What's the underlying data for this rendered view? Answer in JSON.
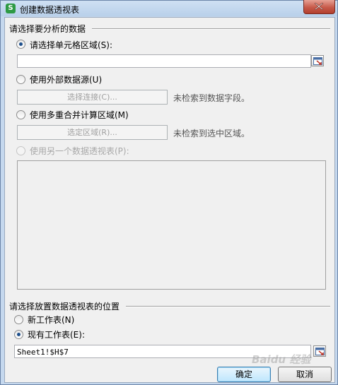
{
  "window": {
    "title": "创建数据透视表",
    "app_icon_glyph": "S",
    "app_icon_color": "#2e9a44",
    "close_icon": "close-icon"
  },
  "source_group": {
    "title": "请选择要分析的数据",
    "options": [
      {
        "label": "请选择单元格区域(S):",
        "checked": true,
        "enabled": true
      },
      {
        "label": "使用外部数据源(U)",
        "checked": false,
        "enabled": true
      },
      {
        "label": "使用多重合并计算区域(M)",
        "checked": false,
        "enabled": true
      },
      {
        "label": "使用另一个数据透视表(P):",
        "checked": false,
        "enabled": false
      }
    ],
    "range_input_value": "",
    "select_connection_button": "选择连接(C)...",
    "connection_note": "未检索到数据字段。",
    "select_range_button": "选定区域(R)...",
    "range_note": "未检索到选中区域。"
  },
  "placement_group": {
    "title": "请选择放置数据透视表的位置",
    "options": [
      {
        "label": "新工作表(N)",
        "checked": false
      },
      {
        "label": "现有工作表(E):",
        "checked": true
      }
    ],
    "location_value": "Sheet1!$H$7"
  },
  "buttons": {
    "ok": "确定",
    "cancel": "取消"
  },
  "watermark": "Baidu 经验"
}
